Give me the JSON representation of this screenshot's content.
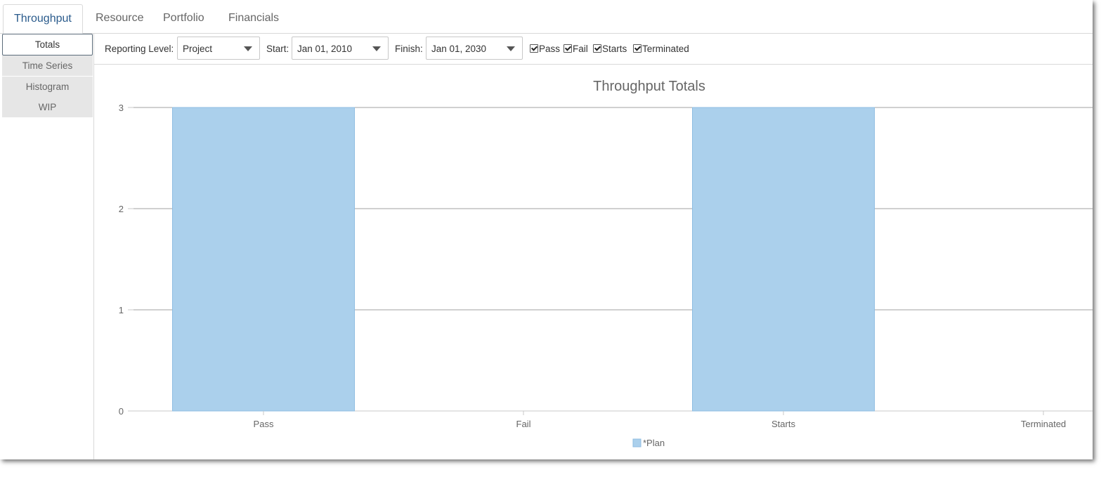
{
  "top_tabs": [
    {
      "label": "Throughput",
      "active": true
    },
    {
      "label": "Resource",
      "active": false
    },
    {
      "label": "Portfolio",
      "active": false
    },
    {
      "label": "Financials",
      "active": false
    }
  ],
  "side_nav": [
    {
      "label": "Totals",
      "active": true
    },
    {
      "label": "Time Series",
      "active": false
    },
    {
      "label": "Histogram",
      "active": false
    },
    {
      "label": "WIP",
      "active": false
    }
  ],
  "toolbar": {
    "reporting_level_label": "Reporting Level:",
    "reporting_level_value": "Project",
    "start_label": "Start:",
    "start_value": "Jan 01, 2010",
    "finish_label": "Finish:",
    "finish_value": "Jan 01, 2030",
    "checkboxes": [
      {
        "label": "Pass",
        "checked": true
      },
      {
        "label": "Fail",
        "checked": true
      },
      {
        "label": "Starts",
        "checked": true
      },
      {
        "label": "Terminated",
        "checked": true
      }
    ]
  },
  "colors": {
    "bar_fill": "#abd0ec",
    "bar_stroke": "#8fbde2",
    "active_tab_text": "#2a5b8c",
    "grid": "#a0a0a0"
  },
  "chart_data": {
    "type": "bar",
    "title": "Throughput Totals",
    "categories": [
      "Pass",
      "Fail",
      "Starts",
      "Terminated"
    ],
    "series": [
      {
        "name": "*Plan",
        "values": [
          3,
          0,
          3,
          0
        ]
      }
    ],
    "yticks": [
      0,
      1,
      2,
      3
    ],
    "ylim": [
      0,
      3
    ],
    "grid": true,
    "legend": "bottom-center",
    "xlabel": "",
    "ylabel": ""
  }
}
